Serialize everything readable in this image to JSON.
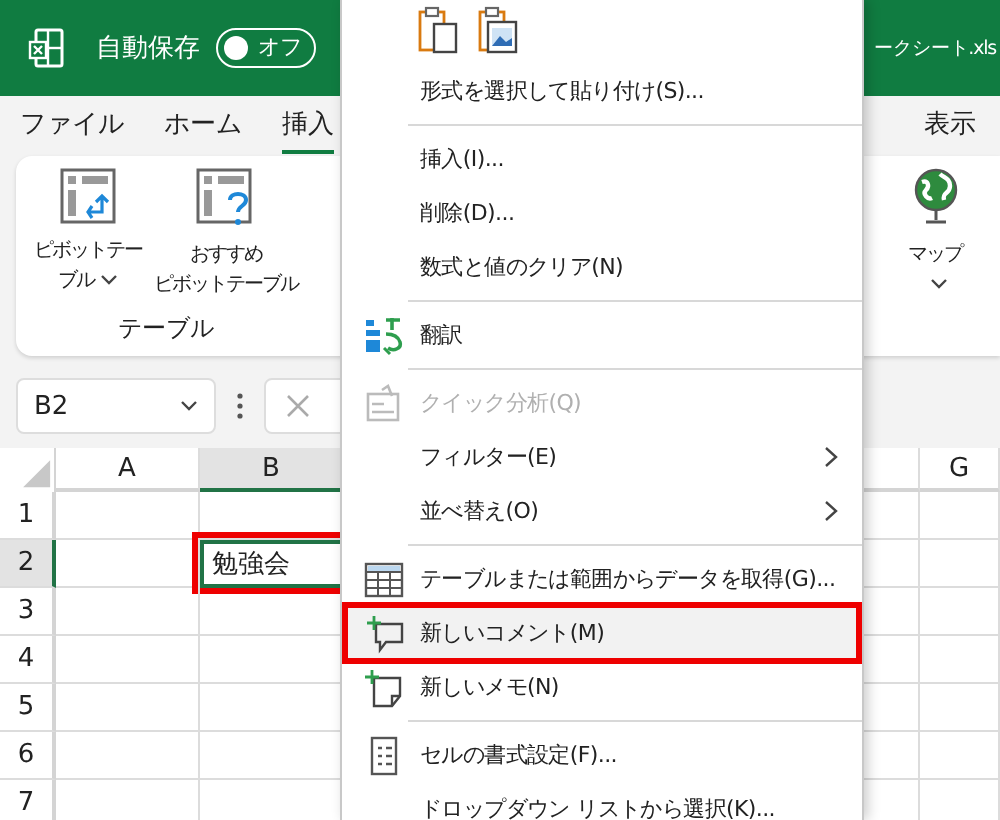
{
  "title_bar": {
    "autosave_label": "自動保存",
    "autosave_toggle": {
      "label": "オフ",
      "on": false
    },
    "file_title": "ークシート.xls"
  },
  "ribbon_tabs": [
    {
      "label": "ファイル",
      "selected": false
    },
    {
      "label": "ホーム",
      "selected": false
    },
    {
      "label": "挿入",
      "selected": true
    },
    {
      "label": "表示",
      "selected": false
    }
  ],
  "ribbon": {
    "groups": [
      {
        "label": "テーブル",
        "buttons": [
          {
            "kind": "pivot",
            "lines": [
              "ピボットテー",
              "ブル"
            ],
            "dropdown": true
          },
          {
            "kind": "recommended",
            "lines": [
              "おすすめ",
              "ピボットテーブル"
            ],
            "dropdown": false
          }
        ]
      }
    ],
    "extra_buttons": [
      {
        "kind": "map",
        "lines": [
          "マップ"
        ],
        "dropdown": true
      }
    ]
  },
  "formula_bar": {
    "name_box": "B2"
  },
  "grid": {
    "columns": [
      {
        "label": "A",
        "selected": false
      },
      {
        "label": "B",
        "selected": true
      },
      {
        "label": "G",
        "selected": false
      }
    ],
    "rows": [
      {
        "label": "1",
        "selected": false
      },
      {
        "label": "2",
        "selected": true,
        "cells": [
          {},
          {
            "value": "勉強会",
            "selected": true,
            "annotated": true
          },
          {}
        ]
      },
      {
        "label": "3",
        "selected": false
      },
      {
        "label": "4",
        "selected": false
      },
      {
        "label": "5",
        "selected": false
      },
      {
        "label": "6",
        "selected": false
      },
      {
        "label": "7",
        "selected": false
      }
    ]
  },
  "context_menu": {
    "paste_options": [
      {
        "kind": "paste"
      },
      {
        "kind": "picture"
      }
    ],
    "items": [
      {
        "kind": "plain",
        "label": "形式を選択して貼り付け(S)...",
        "disabled": false,
        "submenu": false,
        "highlighted": false
      },
      {
        "kind": "separator"
      },
      {
        "kind": "plain",
        "label": "挿入(I)...",
        "disabled": false,
        "submenu": false,
        "highlighted": false
      },
      {
        "kind": "plain",
        "label": "削除(D)...",
        "disabled": false,
        "submenu": false,
        "highlighted": false
      },
      {
        "kind": "plain",
        "label": "数式と値のクリア(N)",
        "disabled": false,
        "submenu": false,
        "highlighted": false
      },
      {
        "kind": "separator"
      },
      {
        "kind": "translate",
        "label": "翻訳",
        "disabled": false,
        "submenu": false,
        "highlighted": false
      },
      {
        "kind": "separator"
      },
      {
        "kind": "analysis",
        "label": "クイック分析(Q)",
        "disabled": true,
        "submenu": false,
        "highlighted": false
      },
      {
        "kind": "plain",
        "label": "フィルター(E)",
        "disabled": false,
        "submenu": true,
        "highlighted": false
      },
      {
        "kind": "plain",
        "label": "並べ替え(O)",
        "disabled": false,
        "submenu": true,
        "highlighted": false
      },
      {
        "kind": "separator"
      },
      {
        "kind": "table",
        "label": "テーブルまたは範囲からデータを取得(G)...",
        "disabled": false,
        "submenu": false,
        "highlighted": false
      },
      {
        "kind": "comment",
        "label": "新しいコメント(M)",
        "disabled": false,
        "submenu": false,
        "highlighted": true
      },
      {
        "kind": "note",
        "label": "新しいメモ(N)",
        "disabled": false,
        "submenu": false,
        "highlighted": false
      },
      {
        "kind": "separator"
      },
      {
        "kind": "format",
        "label": "セルの書式設定(F)...",
        "disabled": false,
        "submenu": false,
        "highlighted": false
      },
      {
        "kind": "plain",
        "label": "ドロップダウン リストから選択(K)...",
        "disabled": false,
        "submenu": false,
        "highlighted": false
      }
    ]
  }
}
